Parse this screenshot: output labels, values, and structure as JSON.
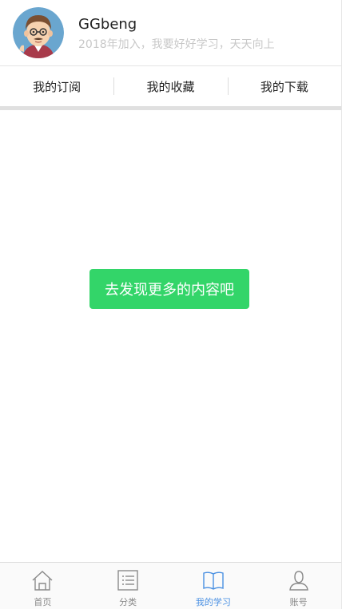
{
  "profile": {
    "username": "GGbeng",
    "bio": "2018年加入，我要好好学习，天天向上"
  },
  "tabs": [
    {
      "label": "我的订阅"
    },
    {
      "label": "我的收藏"
    },
    {
      "label": "我的下载"
    }
  ],
  "content": {
    "discover_label": "去发现更多的内容吧"
  },
  "bottom_nav": [
    {
      "label": "首页",
      "icon": "home-icon"
    },
    {
      "label": "分类",
      "icon": "list-icon"
    },
    {
      "label": "我的学习",
      "icon": "book-icon",
      "active": true
    },
    {
      "label": "账号",
      "icon": "user-icon"
    }
  ],
  "colors": {
    "accent_green": "#33d569",
    "active_blue": "#4a90e2",
    "muted_text": "#c8c8c8"
  }
}
